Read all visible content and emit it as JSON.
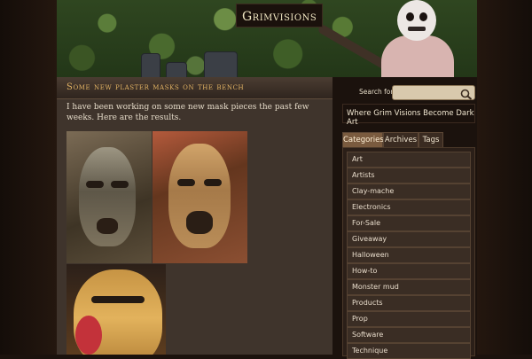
{
  "site": {
    "logo": "Grimvisions",
    "tagline": "Where Grim Visions Become Dark Art"
  },
  "post": {
    "title": "Some new plaster masks on the bench",
    "intro": "I have been working on some new mask pieces the past few weeks. Here are the results."
  },
  "search": {
    "label": "Search for:",
    "placeholder": ""
  },
  "tabs": [
    {
      "label": "Categories",
      "active": true
    },
    {
      "label": "Archives",
      "active": false
    },
    {
      "label": "Tags",
      "active": false
    }
  ],
  "categories": [
    "Art",
    "Artists",
    "Clay-mache",
    "Electronics",
    "For-Sale",
    "Giveaway",
    "Halloween",
    "How-to",
    "Monster mud",
    "Products",
    "Prop",
    "Software",
    "Technique"
  ],
  "icons": {
    "search": "magnifier-icon"
  },
  "colors": {
    "accent_title": "#e2b364",
    "background": "#1b120d"
  }
}
